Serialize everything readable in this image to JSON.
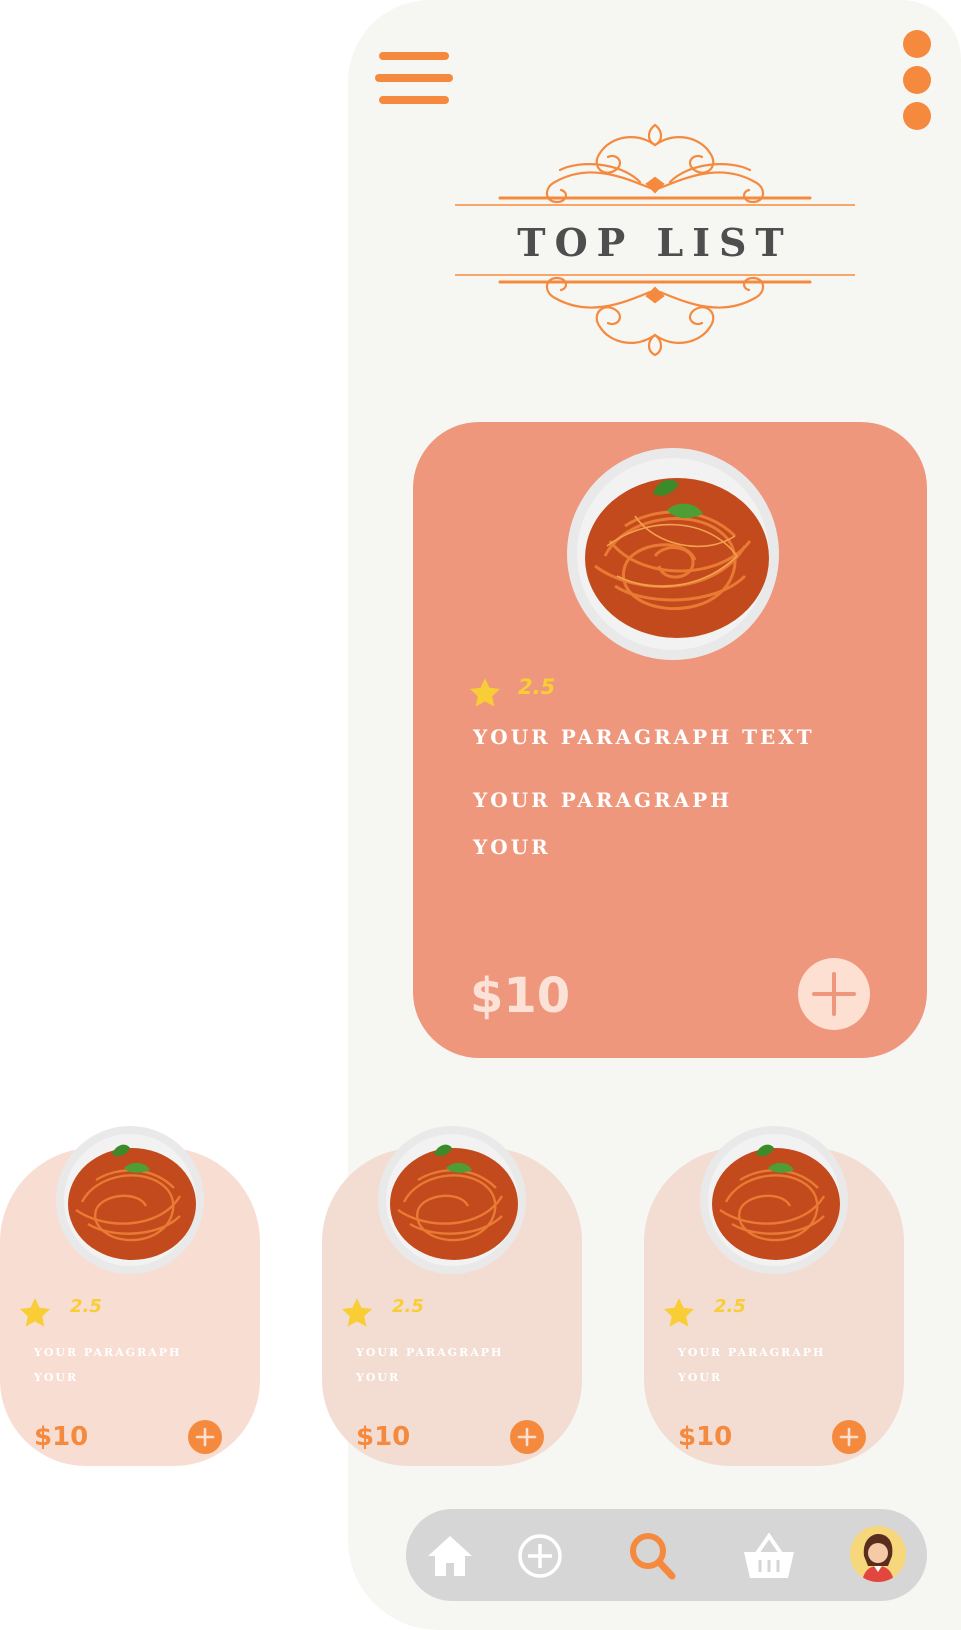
{
  "header": {
    "title": "TOP LIST",
    "menu_icon": "hamburger-menu-icon",
    "more_icon": "vertical-dots-icon"
  },
  "featured": {
    "image_icon": "spaghetti-plate-image",
    "rating": "2.5",
    "line1": "YOUR PARAGRAPH TEXT",
    "line2": "YOUR PARAGRAPH",
    "line3": "YOUR",
    "price": "$10",
    "add_icon": "plus-icon"
  },
  "items": [
    {
      "rating": "2.5",
      "line1": "YOUR PARAGRAPH",
      "line2": "YOUR",
      "price": "$10"
    },
    {
      "rating": "2.5",
      "line1": "YOUR PARAGRAPH",
      "line2": "YOUR",
      "price": "$10"
    },
    {
      "rating": "2.5",
      "line1": "YOUR PARAGRAPH",
      "line2": "YOUR",
      "price": "$10"
    }
  ],
  "nav": {
    "items": [
      "home-icon",
      "add-circle-icon",
      "search-icon",
      "basket-icon",
      "user-avatar"
    ],
    "active": "search-icon"
  },
  "colors": {
    "accent": "#f58a3e",
    "card_main": "#ee977c",
    "card_light": "#f8ddd3",
    "star": "#f8cd35",
    "title": "#4e4e4e",
    "nav_bg": "#d6d6d6"
  }
}
